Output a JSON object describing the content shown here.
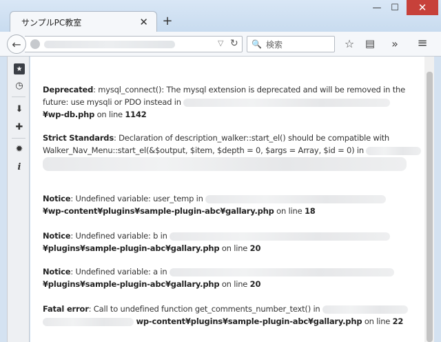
{
  "window": {
    "minimize_glyph": "—",
    "maximize_glyph": "☐",
    "close_glyph": "✕"
  },
  "tabs": [
    {
      "title": "サンプルPC教室",
      "close_glyph": "✕"
    }
  ],
  "new_tab_glyph": "+",
  "navbar": {
    "back_glyph": "←",
    "reload_glyph": "↻",
    "dropdown_glyph": "▽",
    "search_placeholder": "検索",
    "search_glyph": "🔍",
    "bookmark_glyph": "☆",
    "reader_glyph": "▤",
    "overflow_glyph": "»",
    "menu_glyph": "≡"
  },
  "sidebar": {
    "icons": [
      "bookmarks-icon",
      "history-icon",
      "downloads-icon",
      "addons-icon",
      "settings-icon",
      "info-icon"
    ],
    "glyphs": [
      "★",
      "◷",
      "⬇",
      "✚",
      "✹",
      "i"
    ]
  },
  "messages": [
    {
      "level": "Deprecated",
      "line1": ": mysql_connect(): The mysql extension is deprecated and will be removed in the",
      "line2": "future: use mysqli or PDO instead in",
      "path": "¥wp-db.php",
      "on_line": " on line ",
      "line_no": "1142"
    },
    {
      "level": "Strict Standards",
      "line1": ": Declaration of description_walker::start_el() should be compatible with",
      "line2": "Walker_Nav_Menu::start_el(&$output, $item, $depth = 0, $args = Array, $id = 0) in"
    },
    {
      "level": "Notice",
      "text": ": Undefined variable: user_temp in",
      "path": "¥wp-content¥plugins¥sample-plugin-abc¥gallary.php",
      "on_line": " on line ",
      "line_no": "18"
    },
    {
      "level": "Notice",
      "text": ": Undefined variable: b in",
      "path": "¥plugins¥sample-plugin-abc¥gallary.php",
      "on_line": " on line ",
      "line_no": "20"
    },
    {
      "level": "Notice",
      "text": ": Undefined variable: a in",
      "path": "¥plugins¥sample-plugin-abc¥gallary.php",
      "on_line": " on line ",
      "line_no": "20"
    },
    {
      "level": "Fatal error",
      "text": ": Call to undefined function get_comments_number_text() in",
      "path": "wp-content¥plugins¥sample-plugin-abc¥gallary.php",
      "on_line": " on line ",
      "line_no": "22"
    }
  ]
}
